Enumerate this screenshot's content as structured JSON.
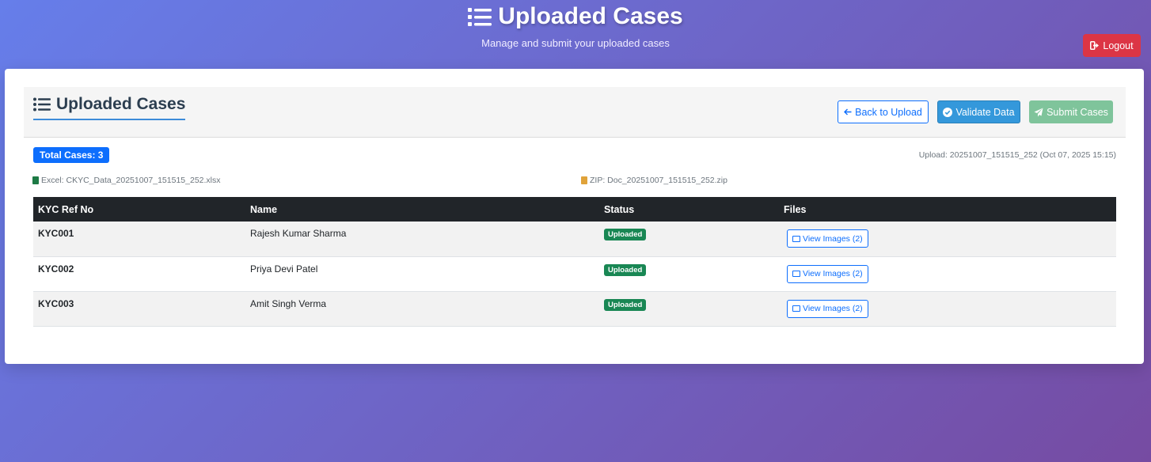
{
  "header": {
    "title": "Uploaded Cases",
    "subtitle": "Manage and submit your uploaded cases",
    "logout_label": "Logout",
    "title_icon": "list-icon",
    "logout_icon": "sign-out-icon"
  },
  "card": {
    "title": "Uploaded Cases",
    "title_icon": "list-icon",
    "buttons": {
      "back_label": "Back to Upload",
      "validate_label": "Validate Data",
      "submit_label": "Submit Cases"
    },
    "total_label": "Total Cases: 3",
    "upload_info": "Upload: 20251007_151515_252 (Oct 07, 2025 15:15)",
    "excel_label": "Excel: CKYC_Data_20251007_151515_252.xlsx",
    "zip_label": "ZIP: Doc_20251007_151515_252.zip"
  },
  "table": {
    "headers": [
      "KYC Ref No",
      "Name",
      "Status",
      "Files"
    ],
    "rows": [
      {
        "ref": "KYC001",
        "name": "Rajesh Kumar Sharma",
        "status": "Uploaded",
        "files": "View Images (2)"
      },
      {
        "ref": "KYC002",
        "name": "Priya Devi Patel",
        "status": "Uploaded",
        "files": "View Images (2)"
      },
      {
        "ref": "KYC003",
        "name": "Amit Singh Verma",
        "status": "Uploaded",
        "files": "View Images (2)"
      }
    ]
  },
  "colors": {
    "gradient_start": "#667eea",
    "gradient_end": "#764ba2",
    "logout": "#dc3545",
    "primary": "#0d6efd",
    "validate": "#3498db",
    "submit": "#7fc49b",
    "status_uploaded": "#198754",
    "table_header": "#212529"
  }
}
